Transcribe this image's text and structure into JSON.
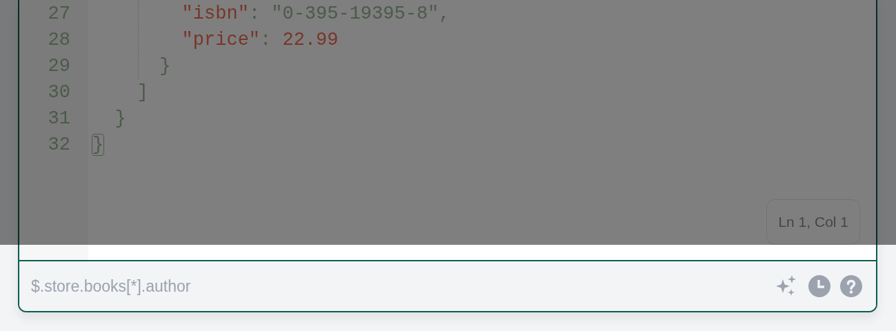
{
  "editor": {
    "lines": [
      {
        "number": "27",
        "tokens": [
          {
            "kind": "key",
            "text": "        \"isbn\"",
            "matched": false
          },
          {
            "kind": "punct",
            "text": ": ",
            "matched": false
          },
          {
            "kind": "string",
            "text": "\"0-395-19395-8\"",
            "matched": false
          },
          {
            "kind": "punct",
            "text": ",",
            "matched": false
          }
        ]
      },
      {
        "number": "28",
        "tokens": [
          {
            "kind": "key",
            "text": "        \"price\"",
            "matched": false
          },
          {
            "kind": "punct",
            "text": ": ",
            "matched": false
          },
          {
            "kind": "number",
            "text": "22.99",
            "matched": false
          }
        ]
      },
      {
        "number": "29",
        "tokens": [
          {
            "kind": "punct",
            "text": "      }",
            "matched": false
          }
        ]
      },
      {
        "number": "30",
        "tokens": [
          {
            "kind": "punct",
            "text": "    ]",
            "matched": false
          }
        ]
      },
      {
        "number": "31",
        "tokens": [
          {
            "kind": "punct",
            "text": "  }",
            "matched": false
          }
        ]
      },
      {
        "number": "32",
        "tokens": [
          {
            "kind": "punct",
            "text": "}",
            "matched": true
          }
        ]
      }
    ],
    "status": "Ln 1, Col 1"
  },
  "query": {
    "placeholder": "$.store.books[*].author"
  }
}
